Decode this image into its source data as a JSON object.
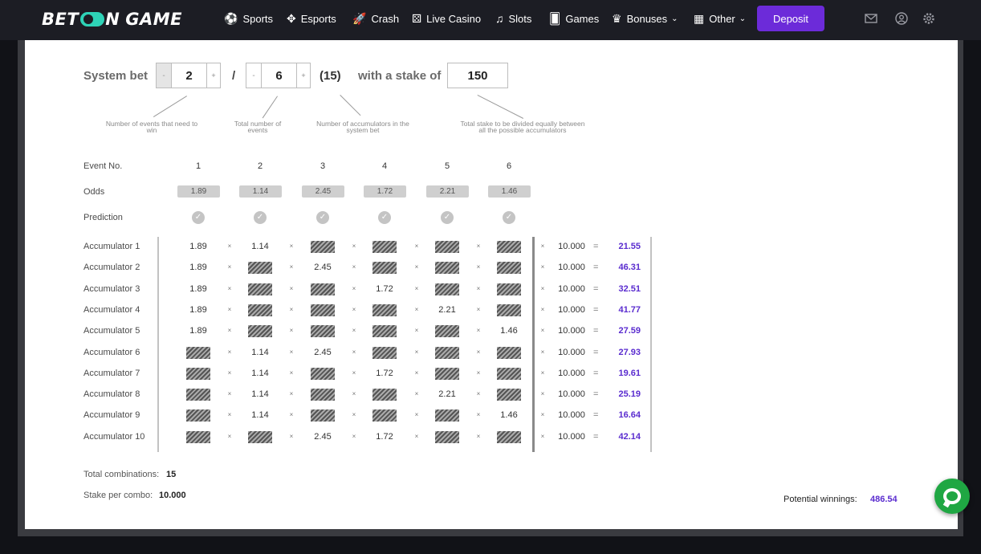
{
  "header": {
    "logo": {
      "left": "BET",
      "right": "GAME"
    },
    "nav": [
      {
        "label": "Sports",
        "icon": "soccer-ball-icon",
        "glyph": "⚽",
        "dropdown": false
      },
      {
        "label": "Esports",
        "icon": "gamepad-icon",
        "glyph": "✥",
        "dropdown": false
      },
      {
        "label": "Crash",
        "icon": "rocket-icon",
        "glyph": "🚀",
        "dropdown": false
      },
      {
        "label": "Live Casino",
        "icon": "dice-icon",
        "glyph": "⚄",
        "dropdown": false
      },
      {
        "label": "Slots",
        "icon": "cherry-icon",
        "glyph": "♫",
        "dropdown": false
      },
      {
        "label": "Games",
        "icon": "cards-icon",
        "glyph": "🂠",
        "dropdown": false
      },
      {
        "label": "Bonuses",
        "icon": "crown-icon",
        "glyph": "♛",
        "dropdown": true
      },
      {
        "label": "Other",
        "icon": "grid-icon",
        "glyph": "▦",
        "dropdown": true
      }
    ],
    "deposit_label": "Deposit",
    "icons": [
      "mail-icon",
      "user-icon",
      "gear-icon"
    ]
  },
  "system": {
    "label": "System bet",
    "events_to_win": "2",
    "separator": "/",
    "total_events": "6",
    "accumulators": "(15)",
    "stake_label": "with a stake of",
    "stake": "150",
    "minus": "-",
    "plus": "+",
    "hints": {
      "events_to_win": "Number of events that need to win",
      "total_events": "Total number of events",
      "accumulators": "Number of accumulators in the system bet",
      "stake": "Total stake to be divided equally between all the possible accumulators"
    }
  },
  "table": {
    "event_no_label": "Event No.",
    "odds_label": "Odds",
    "prediction_label": "Prediction",
    "events": [
      "1",
      "2",
      "3",
      "4",
      "5",
      "6"
    ],
    "odds": [
      "1.89",
      "1.14",
      "2.45",
      "1.72",
      "2.21",
      "1.46"
    ],
    "times": "×",
    "equals": "=",
    "accumulators": [
      {
        "label": "Accumulator 1",
        "cells": [
          "1.89",
          "1.14",
          null,
          null,
          null,
          null
        ],
        "stake": "10.000",
        "result": "21.55"
      },
      {
        "label": "Accumulator 2",
        "cells": [
          "1.89",
          null,
          "2.45",
          null,
          null,
          null
        ],
        "stake": "10.000",
        "result": "46.31"
      },
      {
        "label": "Accumulator 3",
        "cells": [
          "1.89",
          null,
          null,
          "1.72",
          null,
          null
        ],
        "stake": "10.000",
        "result": "32.51"
      },
      {
        "label": "Accumulator 4",
        "cells": [
          "1.89",
          null,
          null,
          null,
          "2.21",
          null
        ],
        "stake": "10.000",
        "result": "41.77"
      },
      {
        "label": "Accumulator 5",
        "cells": [
          "1.89",
          null,
          null,
          null,
          null,
          "1.46"
        ],
        "stake": "10.000",
        "result": "27.59"
      },
      {
        "label": "Accumulator 6",
        "cells": [
          null,
          "1.14",
          "2.45",
          null,
          null,
          null
        ],
        "stake": "10.000",
        "result": "27.93"
      },
      {
        "label": "Accumulator 7",
        "cells": [
          null,
          "1.14",
          null,
          "1.72",
          null,
          null
        ],
        "stake": "10.000",
        "result": "19.61"
      },
      {
        "label": "Accumulator 8",
        "cells": [
          null,
          "1.14",
          null,
          null,
          "2.21",
          null
        ],
        "stake": "10.000",
        "result": "25.19"
      },
      {
        "label": "Accumulator 9",
        "cells": [
          null,
          "1.14",
          null,
          null,
          null,
          "1.46"
        ],
        "stake": "10.000",
        "result": "16.64"
      },
      {
        "label": "Accumulator 10",
        "cells": [
          null,
          null,
          "2.45",
          "1.72",
          null,
          null
        ],
        "stake": "10.000",
        "result": "42.14"
      }
    ]
  },
  "footer": {
    "total_combinations_label": "Total combinations:",
    "total_combinations": "15",
    "stake_per_combo_label": "Stake per combo:",
    "stake_per_combo": "10.000",
    "potential_winnings_label": "Potential winnings:",
    "potential_winnings": "486.54"
  }
}
